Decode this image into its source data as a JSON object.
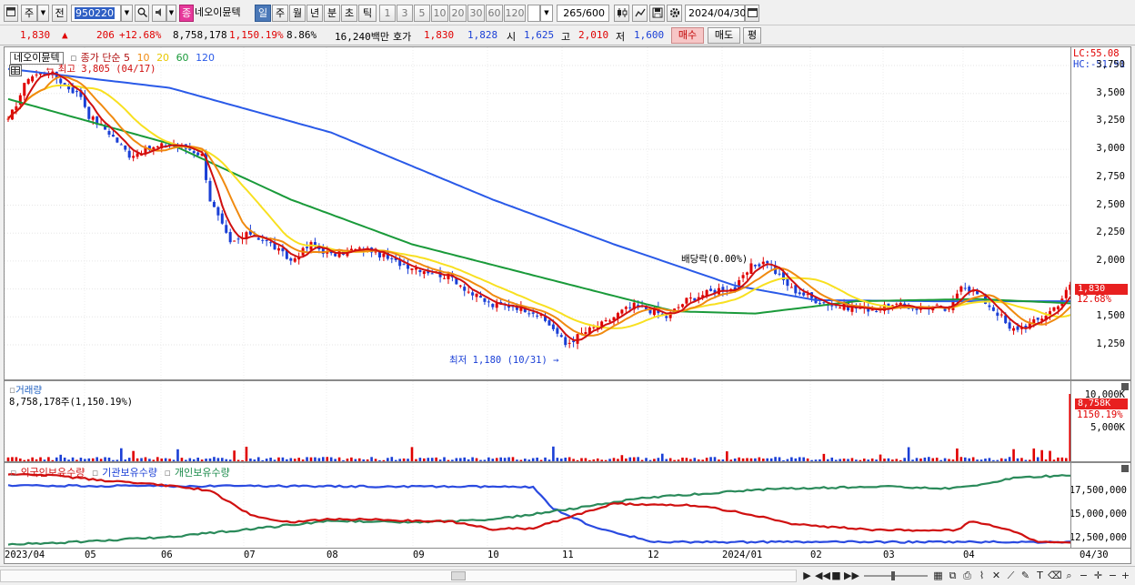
{
  "toolbar": {
    "market_prefix": "주",
    "prev_label": "전",
    "code": "950220",
    "type_badge": "종",
    "stock_name": "네오이뮨텍",
    "period_buttons": [
      "일",
      "주",
      "월",
      "년",
      "분",
      "초",
      "틱"
    ],
    "active_period": "일",
    "interval_buttons": [
      "1",
      "3",
      "5",
      "10",
      "20",
      "30",
      "60",
      "120"
    ],
    "count": "265",
    "count_max": "/600",
    "date": "2024/04/30"
  },
  "info": {
    "price": "1,830",
    "change": "206",
    "change_pct": "+12.68%",
    "volume": "8,758,178",
    "volume_pct": "1,150.19%",
    "turnover": "8.86%",
    "amount": "16,240백만",
    "quote_label": "호가",
    "ask": "1,830",
    "bid": "1,828",
    "open_label": "시",
    "open": "1,625",
    "high_label": "고",
    "high": "2,010",
    "low_label": "저",
    "low": "1,600",
    "buy_label": "매수",
    "sell_label": "매도",
    "avg_label": "평"
  },
  "price_pane": {
    "name_tag": "네오이뮨텍",
    "legend_main": "종가 단순 5",
    "ma_periods": [
      "10",
      "20",
      "60",
      "120"
    ],
    "lc": "LC:55.08",
    "hc": "HC:-51.91",
    "last_price": "1,830",
    "last_pct": "12.68%",
    "annotation_high": "최고 3,805 (04/17)",
    "annotation_low": "최저 1,180 (10/31)",
    "annotation_dividend": "배당락(0.00%)",
    "y_ticks": [
      "3,750",
      "3,500",
      "3,250",
      "3,000",
      "2,750",
      "2,500",
      "2,250",
      "2,000",
      "1,750",
      "1,500",
      "1,250"
    ]
  },
  "volume_pane": {
    "title": "거래량",
    "value_text": "8,758,178주(1,150.19%)",
    "y_ticks": [
      "10,000K",
      "5,000K"
    ],
    "last_volume": "8,758K",
    "last_pct": "1150.19%"
  },
  "holder_pane": {
    "series_labels": [
      "외국인보유수량",
      "기관보유수량",
      "개인보유수량"
    ],
    "y_ticks": [
      "17,500,000",
      "15,000,000",
      "12,500,000"
    ]
  },
  "x_axis": {
    "labels": [
      "2023/04",
      "05",
      "06",
      "07",
      "08",
      "09",
      "10",
      "11",
      "12",
      "2024/01",
      "02",
      "03",
      "04"
    ],
    "end_label": "04/30"
  },
  "colors": {
    "up": "#e00000",
    "down": "#1a3fd6",
    "ma5": "#d01010",
    "ma10": "#f08a10",
    "ma20": "#f8e020",
    "ma60": "#1a9a3a",
    "ma120": "#2a5ae8"
  },
  "chart_data": {
    "type": "line",
    "title": "",
    "x": [
      "2023/04",
      "05",
      "06",
      "07",
      "08",
      "09",
      "10",
      "11",
      "12",
      "2024/01",
      "02",
      "03",
      "04"
    ],
    "ylim": [
      1150,
      3850
    ],
    "series": [
      {
        "name": "종가",
        "values": [
          3550,
          3150,
          3000,
          2150,
          2050,
          1920,
          1560,
          1400,
          1620,
          1720,
          1600,
          1580,
          1830
        ]
      }
    ]
  }
}
